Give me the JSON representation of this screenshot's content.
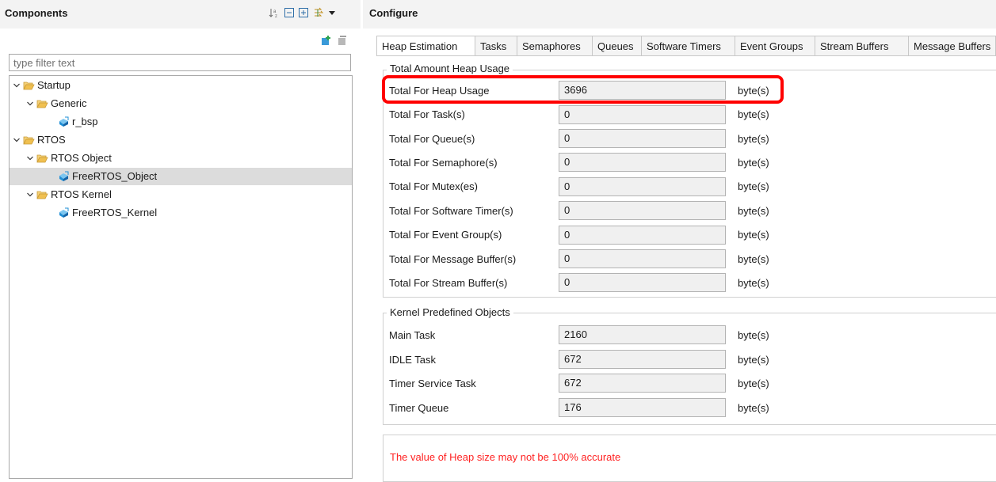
{
  "components_panel": {
    "title": "Components",
    "filter_placeholder": "type filter text",
    "tree": [
      {
        "label": "Startup",
        "icon": "folder-open-icon",
        "expanded": true
      },
      {
        "label": "Generic",
        "icon": "folder-open-icon",
        "expanded": true
      },
      {
        "label": "r_bsp",
        "icon": "component-icon"
      },
      {
        "label": "RTOS",
        "icon": "folder-open-icon",
        "expanded": true
      },
      {
        "label": "RTOS Object",
        "icon": "folder-open-icon",
        "expanded": true
      },
      {
        "label": "FreeRTOS_Object",
        "icon": "component-icon",
        "selected": true
      },
      {
        "label": "RTOS Kernel",
        "icon": "folder-open-icon",
        "expanded": true
      },
      {
        "label": "FreeRTOS_Kernel",
        "icon": "component-icon"
      }
    ]
  },
  "configure_panel": {
    "title": "Configure",
    "tabs": [
      "Heap Estimation",
      "Tasks",
      "Semaphores",
      "Queues",
      "Software Timers",
      "Event Groups",
      "Stream Buffers",
      "Message Buffers"
    ],
    "active_tab": "Heap Estimation",
    "total_group": {
      "title": "Total Amount Heap Usage",
      "rows": [
        {
          "label": "Total For Heap Usage",
          "value": "3696",
          "unit": "byte(s)"
        },
        {
          "label": "Total For Task(s)",
          "value": "0",
          "unit": "byte(s)"
        },
        {
          "label": "Total For Queue(s)",
          "value": "0",
          "unit": "byte(s)"
        },
        {
          "label": "Total For Semaphore(s)",
          "value": "0",
          "unit": "byte(s)"
        },
        {
          "label": "Total For Mutex(es)",
          "value": "0",
          "unit": "byte(s)"
        },
        {
          "label": "Total For Software Timer(s)",
          "value": "0",
          "unit": "byte(s)"
        },
        {
          "label": "Total For Event Group(s)",
          "value": "0",
          "unit": "byte(s)"
        },
        {
          "label": "Total For Message Buffer(s)",
          "value": "0",
          "unit": "byte(s)"
        },
        {
          "label": "Total For Stream Buffer(s)",
          "value": "0",
          "unit": "byte(s)"
        }
      ]
    },
    "kernel_group": {
      "title": "Kernel Predefined Objects",
      "rows": [
        {
          "label": "Main Task",
          "value": "2160",
          "unit": "byte(s)"
        },
        {
          "label": "IDLE Task",
          "value": "672",
          "unit": "byte(s)"
        },
        {
          "label": "Timer Service Task",
          "value": "672",
          "unit": "byte(s)"
        },
        {
          "label": "Timer Queue",
          "value": "176",
          "unit": "byte(s)"
        }
      ]
    },
    "note": "The value of Heap size may not be 100% accurate"
  },
  "colors": {
    "highlight": "#ff0000",
    "note_text": "#ff2222",
    "folder": "#e8b04a",
    "component": "#1f8fd6"
  }
}
